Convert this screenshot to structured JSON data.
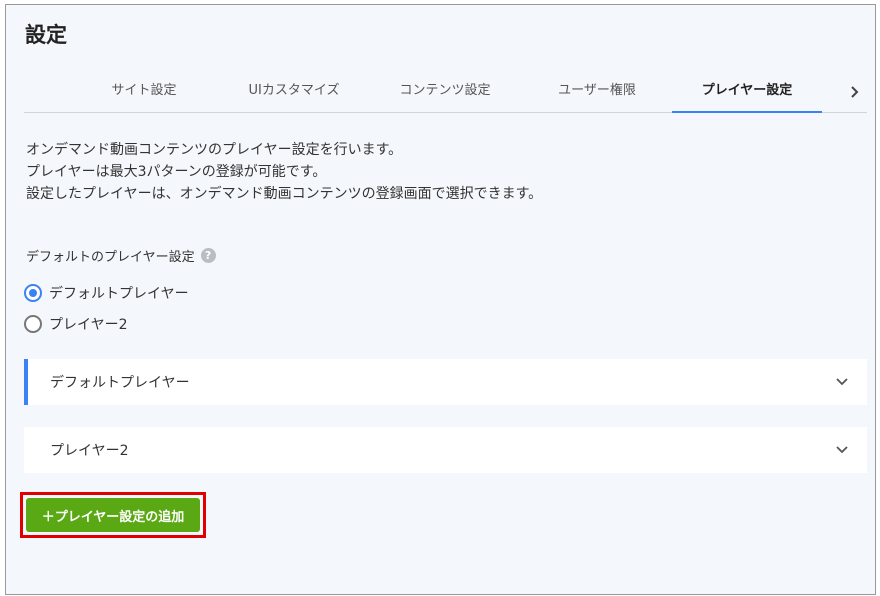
{
  "page": {
    "title": "設定"
  },
  "tabs": [
    {
      "label": "サイト設定",
      "active": false
    },
    {
      "label": "UIカスタマイズ",
      "active": false
    },
    {
      "label": "コンテンツ設定",
      "active": false
    },
    {
      "label": "ユーザー権限",
      "active": false
    },
    {
      "label": "プレイヤー設定",
      "active": true
    }
  ],
  "description": [
    "オンデマンド動画コンテンツのプレイヤー設定を行います。",
    "プレイヤーは最大3パターンの登録が可能です。",
    "設定したプレイヤーは、オンデマンド動画コンテンツの登録画面で選択できます。"
  ],
  "default_setting": {
    "label": "デフォルトのプレイヤー設定",
    "help_icon": "?",
    "options": [
      {
        "label": "デフォルトプレイヤー",
        "checked": true
      },
      {
        "label": "プレイヤー2",
        "checked": false
      }
    ]
  },
  "panels": [
    {
      "label": "デフォルトプレイヤー"
    },
    {
      "label": "プレイヤー2"
    }
  ],
  "add_button": {
    "label": "＋プレイヤー設定の追加"
  },
  "colors": {
    "accent": "#3b82f6",
    "add_button": "#5aa814",
    "highlight": "#e00000"
  }
}
